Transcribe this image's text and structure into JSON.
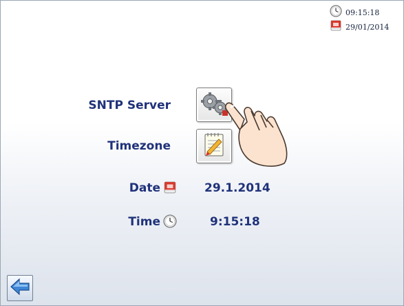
{
  "status": {
    "time": "09:15:18",
    "date": "29/01/2014"
  },
  "settings": {
    "sntp_label": "SNTP Server",
    "timezone_label": "Timezone",
    "date_label": "Date",
    "date_value": "29.1.2014",
    "time_label": "Time",
    "time_value": "9:15:18"
  },
  "icons": {
    "status_time": "clock-icon",
    "status_date": "calendar-icon",
    "sntp_button": "gears-icon",
    "timezone_button": "notepad-pencil-icon",
    "date_label": "calendar-icon",
    "time_label": "clock-icon",
    "back_button": "arrow-left-icon",
    "pointer": "hand-pointer-icon"
  },
  "colors": {
    "label_text": "#20327a",
    "back_arrow": "#3f86d6",
    "calendar_red": "#d8372b"
  }
}
